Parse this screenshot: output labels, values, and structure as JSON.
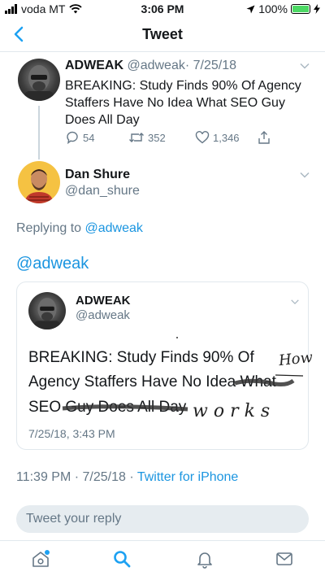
{
  "status_bar": {
    "carrier": "voda MT",
    "time": "3:06 PM",
    "battery_percent": "100%",
    "battery_level": 1.0
  },
  "nav": {
    "title": "Tweet",
    "back_icon": "chevron-left-icon"
  },
  "parent_tweet": {
    "name": "ADWEAK",
    "handle": "@adweak",
    "date": "· 7/25/18",
    "text": "BREAKING: Study Finds 90% Of Agency Staffers Have No Idea What SEO Guy Does All Day",
    "replies": "54",
    "retweets": "352",
    "likes": "1,346"
  },
  "main_tweet": {
    "name": "Dan Shure",
    "handle": "@dan_shure",
    "replying_prefix": "Replying to ",
    "replying_to": "@adweak",
    "text": "@adweak",
    "timestamp": "11:39 PM · 7/25/18 · ",
    "source": "Twitter for iPhone"
  },
  "embedded_image": {
    "name": "ADWEAK",
    "handle": "@adweak",
    "text_line1": "BREAKING: Study Finds 90% Of",
    "text_line2": "Agency Staffers Have No Idea What",
    "text_line3a": "SEO ",
    "text_line3b": "Guy Does All Day",
    "date": "7/25/18, 3:43 PM",
    "handwritten_1": "How",
    "handwritten_2": "works"
  },
  "reply": {
    "placeholder": "Tweet your reply"
  },
  "tabs": [
    "home-icon",
    "search-icon",
    "notifications-icon",
    "messages-icon"
  ],
  "colors": {
    "accent": "#1da1f2",
    "link": "#1b95e0",
    "muted": "#657786"
  }
}
